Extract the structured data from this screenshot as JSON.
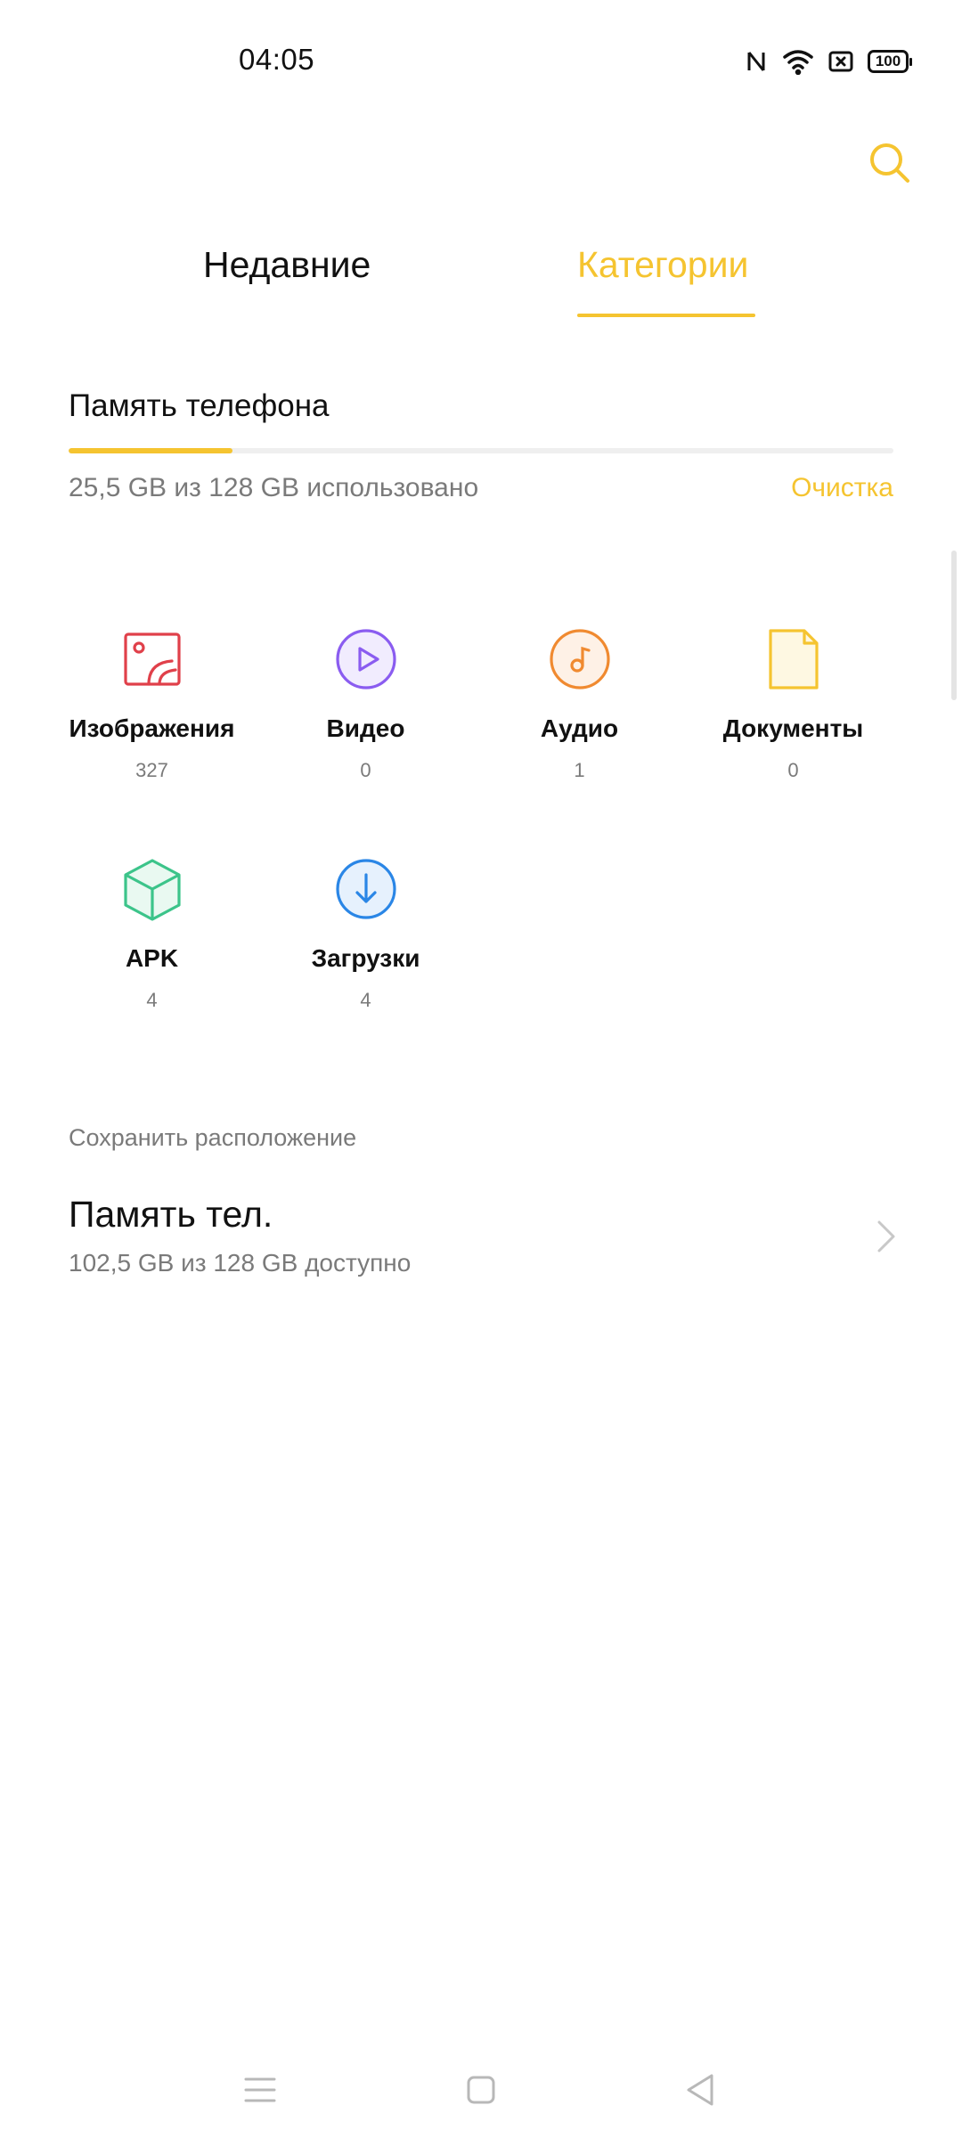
{
  "status_bar": {
    "time": "04:05",
    "battery": "100",
    "icons": [
      "nfc-icon",
      "wifi-icon",
      "sim-off-icon",
      "battery-icon"
    ]
  },
  "header": {
    "search_icon": "search-icon"
  },
  "tabs": [
    {
      "label": "Недавние",
      "active": false
    },
    {
      "label": "Категории",
      "active": true
    }
  ],
  "storage": {
    "title": "Память телефона",
    "used_text": "25,5 GB из 128 GB использовано",
    "used_fraction": 0.199,
    "cleanup_label": "Очистка"
  },
  "categories": [
    {
      "label": "Изображения",
      "count": "327",
      "icon": "image-icon",
      "color": "#e0404a"
    },
    {
      "label": "Видео",
      "count": "0",
      "icon": "play-icon",
      "color": "#8a5cf0"
    },
    {
      "label": "Аудио",
      "count": "1",
      "icon": "music-note-icon",
      "color": "#f08a30"
    },
    {
      "label": "Документы",
      "count": "0",
      "icon": "document-icon",
      "color": "#f5c430"
    },
    {
      "label": "APK",
      "count": "4",
      "icon": "package-icon",
      "color": "#3cc48a"
    },
    {
      "label": "Загрузки",
      "count": "4",
      "icon": "download-icon",
      "color": "#2a86e6"
    }
  ],
  "save_location": {
    "header": "Сохранить расположение",
    "title": "Память тел.",
    "subtitle": "102,5 GB из 128 GB доступно"
  },
  "nav_bar": {
    "icons": [
      "menu-icon",
      "home-icon",
      "back-icon"
    ]
  },
  "colors": {
    "accent": "#f5c430",
    "text_primary": "#111111",
    "text_secondary": "#7a7a7a",
    "track": "#efefef"
  }
}
